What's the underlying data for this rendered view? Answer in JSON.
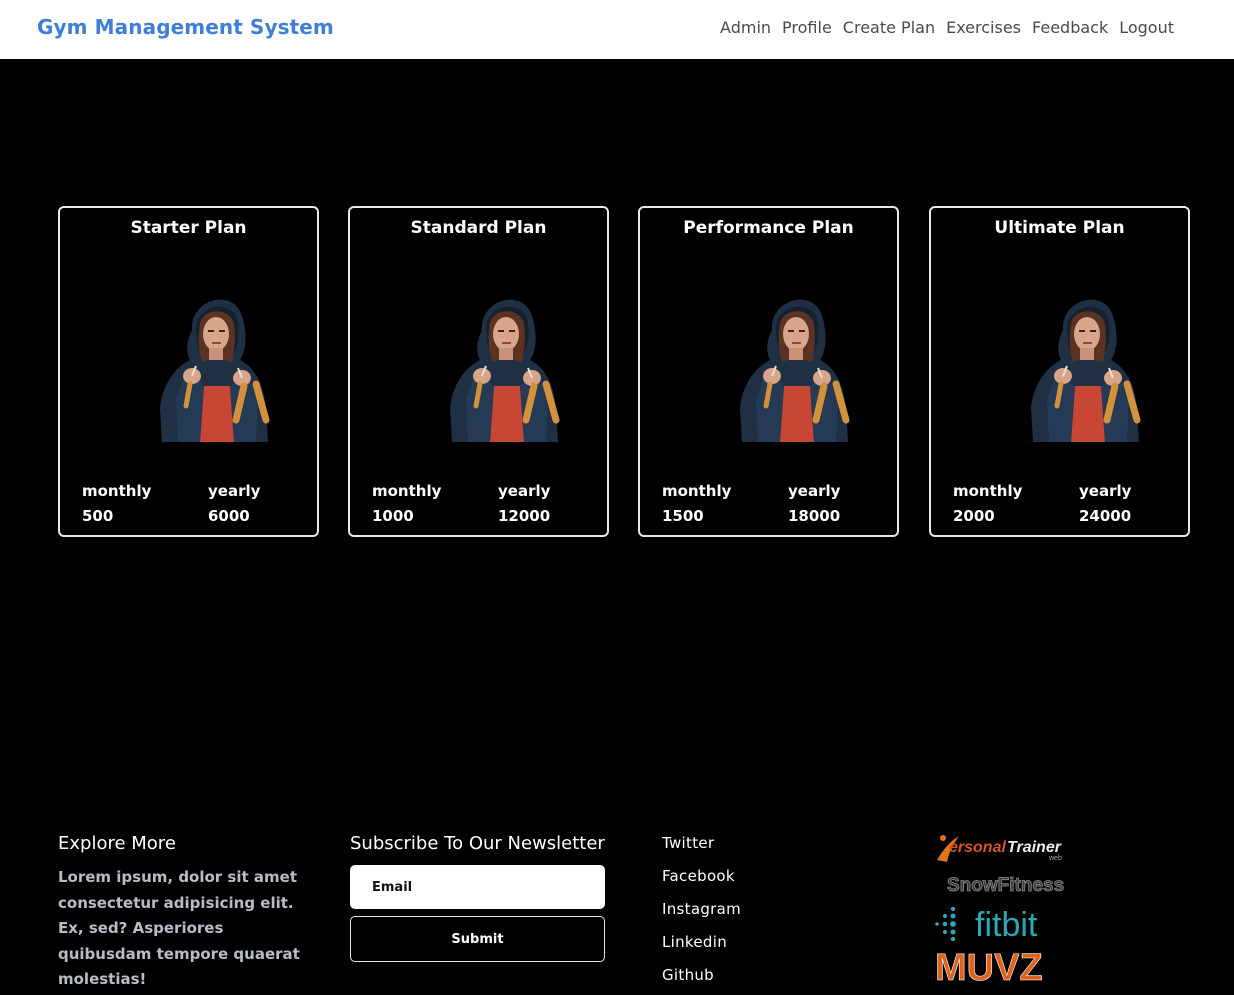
{
  "navbar": {
    "brand": "Gym Management System",
    "links": [
      "Admin",
      "Profile",
      "Create Plan",
      "Exercises",
      "Feedback",
      "Logout"
    ]
  },
  "plans": [
    {
      "title": "Starter Plan",
      "monthly_label": "monthly",
      "yearly_label": "yearly",
      "monthly_price": "500",
      "yearly_price": "6000"
    },
    {
      "title": "Standard Plan",
      "monthly_label": "monthly",
      "yearly_label": "yearly",
      "monthly_price": "1000",
      "yearly_price": "12000"
    },
    {
      "title": "Performance Plan",
      "monthly_label": "monthly",
      "yearly_label": "yearly",
      "monthly_price": "1500",
      "yearly_price": "18000"
    },
    {
      "title": "Ultimate Plan",
      "monthly_label": "monthly",
      "yearly_label": "yearly",
      "monthly_price": "2000",
      "yearly_price": "24000"
    }
  ],
  "footer": {
    "explore": {
      "heading": "Explore More",
      "text": "Lorem ipsum, dolor sit amet consectetur adipisicing elit. Ex, sed? Asperiores quibusdam tempore quaerat molestias!"
    },
    "newsletter": {
      "heading": "Subscribe To Our Newsletter",
      "email_placeholder": "Email",
      "submit_label": "Submit"
    },
    "social": [
      "Twitter",
      "Facebook",
      "Instagram",
      "Linkedin",
      "Github"
    ],
    "partner_logos": [
      "personalTrainer web",
      "SnowFitness",
      "fitbit",
      "MUVZ"
    ]
  },
  "colors": {
    "brand": "#3d7fd9",
    "background": "#000000",
    "card_border": "#e8e8e8",
    "nav_text": "#4a4a4a",
    "muted_text": "#b9bcc4"
  }
}
